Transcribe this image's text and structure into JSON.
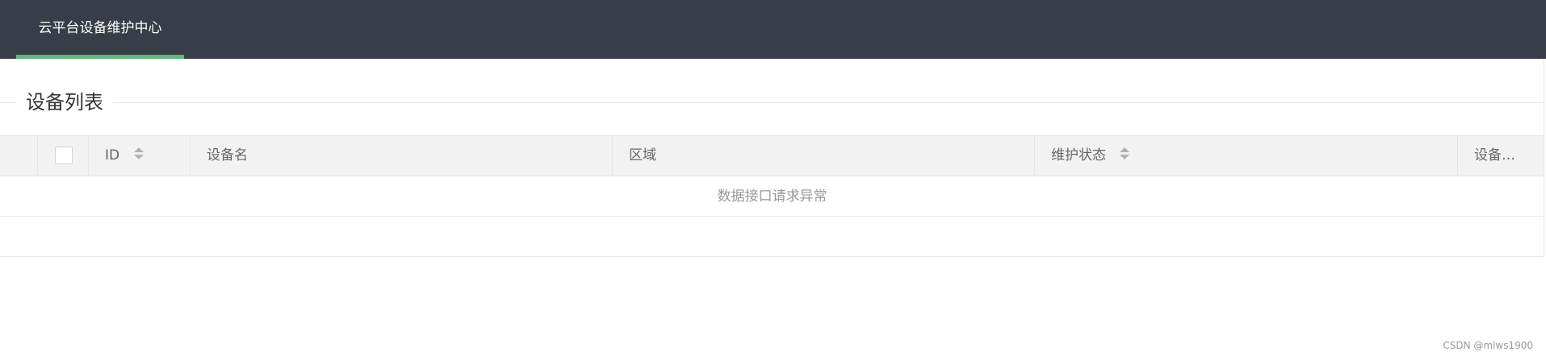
{
  "header": {
    "nav_title": "云平台设备维护中心",
    "accent_color": "#5fb878",
    "bg_color": "#393d49"
  },
  "section": {
    "legend": "设备列表"
  },
  "table": {
    "columns": [
      {
        "label": "ID",
        "sortable": true
      },
      {
        "label": "设备名",
        "sortable": false
      },
      {
        "label": "区域",
        "sortable": false
      },
      {
        "label": "维护状态",
        "sortable": true
      },
      {
        "label": "设备…",
        "sortable": false
      }
    ],
    "empty_message": "数据接口请求异常"
  },
  "footer": {
    "watermark": "CSDN @mlws1900"
  }
}
